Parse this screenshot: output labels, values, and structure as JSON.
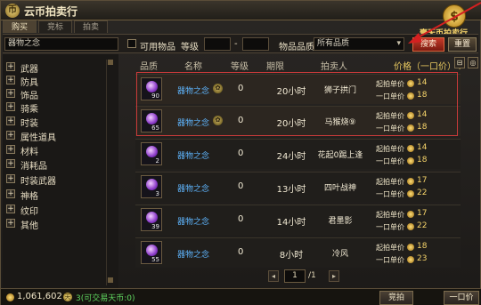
{
  "window": {
    "title": "云币拍卖行",
    "coin_button_label": "壹天币拍卖行"
  },
  "tabs": [
    {
      "label": "购买"
    },
    {
      "label": "竞标"
    },
    {
      "label": "拍卖"
    }
  ],
  "filter": {
    "search_value": "器物之念",
    "usable_label": "可用物品",
    "level_label": "等级",
    "level_sep": "-",
    "quality_label": "物品品质",
    "quality_value": "所有品质",
    "search_button": "搜索",
    "reset_button": "重置"
  },
  "categories": [
    {
      "label": "武器"
    },
    {
      "label": "防具"
    },
    {
      "label": "饰品"
    },
    {
      "label": "骑乘"
    },
    {
      "label": "时装"
    },
    {
      "label": "属性道具"
    },
    {
      "label": "材料"
    },
    {
      "label": "消耗品"
    },
    {
      "label": "时装武器"
    },
    {
      "label": "神格"
    },
    {
      "label": "纹印"
    },
    {
      "label": "其他"
    }
  ],
  "columns": {
    "quality": "品质",
    "name": "名称",
    "level": "等级",
    "period": "期限",
    "seller": "拍卖人",
    "price": "价格（一口价）↑"
  },
  "rows": [
    {
      "level_num": "90",
      "name": "器物之念",
      "count": "0",
      "period": "20小时",
      "seller": "狮子拱门",
      "start_label": "起拍单价",
      "start": "14",
      "buy_label": "一口单价",
      "buy": "18",
      "badge": "✿"
    },
    {
      "level_num": "65",
      "name": "器物之念",
      "count": "0",
      "period": "20小时",
      "seller": "马猴烧⑨",
      "start_label": "起拍单价",
      "start": "14",
      "buy_label": "一口单价",
      "buy": "18",
      "badge": "✿"
    },
    {
      "level_num": "2",
      "name": "器物之念",
      "count": "0",
      "period": "24小时",
      "seller": "花起0踢上逢",
      "start_label": "起拍单价",
      "start": "14",
      "buy_label": "一口单价",
      "buy": "18"
    },
    {
      "level_num": "3",
      "name": "器物之念",
      "count": "0",
      "period": "13小时",
      "seller": "四叶战神",
      "start_label": "起拍单价",
      "start": "17",
      "buy_label": "一口单价",
      "buy": "22"
    },
    {
      "level_num": "39",
      "name": "器物之念",
      "count": "0",
      "period": "14小时",
      "seller": "君墨影",
      "start_label": "起拍单价",
      "start": "17",
      "buy_label": "一口单价",
      "buy": "22"
    },
    {
      "level_num": "55",
      "name": "器物之念",
      "count": "0",
      "period": "8小时",
      "seller": "冷风",
      "start_label": "起拍单价",
      "start": "18",
      "buy_label": "一口单价",
      "buy": "23"
    }
  ],
  "pager": {
    "page": "1",
    "total": "/1"
  },
  "bottom": {
    "money": "1,061,602",
    "tradable": "3(可交易天币:0)",
    "bid_button": "竞拍",
    "buyout_button": "一口价"
  }
}
